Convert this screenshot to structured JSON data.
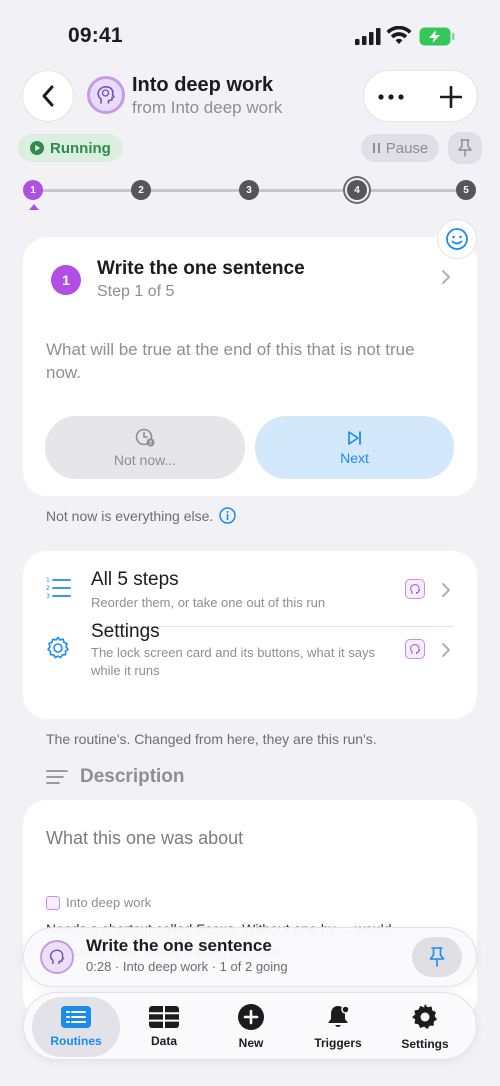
{
  "status_bar": {
    "time": "09:41"
  },
  "nav": {
    "title": "Into deep work",
    "subtitle": "from Into deep work"
  },
  "run_state": {
    "running_label": "Running",
    "pause_label": "Pause"
  },
  "stepper": {
    "steps": [
      "1",
      "2",
      "3",
      "4",
      "5"
    ],
    "current": 1
  },
  "step_card": {
    "number": "1",
    "title": "Write the one sentence",
    "count": "Step 1 of 5",
    "description": "What will be true at the end of this that is not true now.",
    "not_now_label": "Not now...",
    "next_label": "Next"
  },
  "hint": "Not now is everything else.",
  "list": {
    "steps_title": "All 5 steps",
    "steps_sub": "Reorder them, or take one out of this run",
    "settings_title": "Settings",
    "settings_sub": "The lock screen card and its buttons, what it says while it runs"
  },
  "footnote": "The routine's. Changed from here, they are this run's.",
  "description": {
    "heading": "Description",
    "placeholder": "What this one was about",
    "source": "Into deep work",
    "body": "Needs a shortcut called Focus. Without one by ... would. Reassure your settings when it's done."
  },
  "now_playing": {
    "title": "Write the one sentence",
    "subtitle": "0:28 · Into deep work · 1 of 2 going"
  },
  "tabs": [
    {
      "label": "Routines",
      "icon": "list-icon"
    },
    {
      "label": "Data",
      "icon": "table-icon"
    },
    {
      "label": "New",
      "icon": "plus-circle-icon"
    },
    {
      "label": "Triggers",
      "icon": "bell-icon"
    },
    {
      "label": "Settings",
      "icon": "gear-icon"
    }
  ],
  "colors": {
    "accent_purple": "#b14fe3",
    "accent_blue": "#1a8cf0",
    "running_green": "#2e8b4a"
  }
}
